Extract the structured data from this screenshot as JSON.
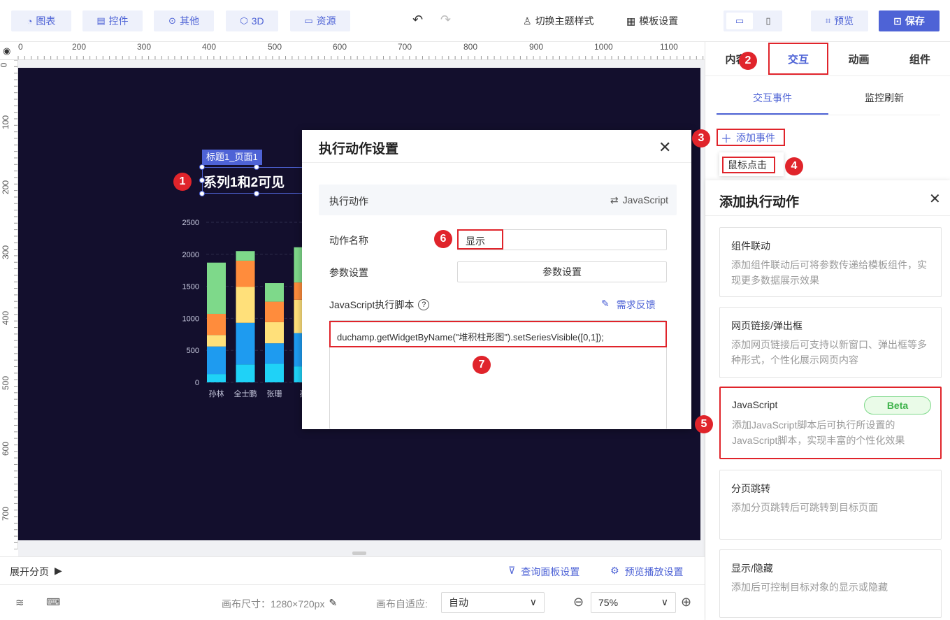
{
  "toolbar": {
    "chart": "图表",
    "widget": "控件",
    "other": "其他",
    "three_d": "3D",
    "resource": "资源",
    "switch_theme": "切换主题样式",
    "template_settings": "模板设置",
    "preview": "预览",
    "save": "保存"
  },
  "ruler": {
    "top": [
      "0",
      "200",
      "300",
      "400",
      "500",
      "600",
      "700",
      "800",
      "900",
      "1000",
      "1100"
    ],
    "left": [
      "0",
      "100",
      "200",
      "300",
      "400",
      "500",
      "600",
      "700"
    ]
  },
  "canvas": {
    "title_tag": "标题1_页面1",
    "title_text": "系列1和2可见"
  },
  "chart_data": {
    "type": "bar",
    "stacked": true,
    "categories": [
      "孙林",
      "全士鹏",
      "张珊",
      "孙"
    ],
    "ylim": [
      0,
      2500
    ],
    "yticks": [
      0,
      500,
      1000,
      1500,
      2000,
      2500
    ],
    "series": [
      {
        "color": "#1fd2f7",
        "values": [
          130,
          280,
          290,
          250
        ]
      },
      {
        "color": "#1e9bf0",
        "values": [
          430,
          650,
          320,
          520
        ]
      },
      {
        "color": "#ffe07a",
        "values": [
          180,
          560,
          330,
          520
        ]
      },
      {
        "color": "#ff8c3c",
        "values": [
          330,
          410,
          320,
          270
        ]
      },
      {
        "color": "#7ed98a",
        "values": [
          800,
          150,
          290,
          550
        ]
      }
    ]
  },
  "dialog": {
    "title": "执行动作设置",
    "exec_action_label": "执行动作",
    "exec_action_value": "JavaScript",
    "action_name_label": "动作名称",
    "action_name_value": "显示",
    "params_label": "参数设置",
    "params_button": "参数设置",
    "script_label": "JavaScript执行脚本",
    "feedback": "需求反馈",
    "script_code": "duchamp.getWidgetByName(\"堆积柱形图\").setSeriesVisible([0,1]);"
  },
  "right_panel": {
    "tabs": [
      "内容",
      "交互",
      "动画",
      "组件"
    ],
    "subtabs": [
      "交互事件",
      "监控刷新"
    ],
    "add_event": "添加事件",
    "event_item": "鼠标点击",
    "add_action_title": "添加执行动作",
    "cards": [
      {
        "title": "组件联动",
        "desc": "添加组件联动后可将参数传递给模板组件，实现更多数据展示效果"
      },
      {
        "title": "网页链接/弹出框",
        "desc": "添加网页链接后可支持以新窗口、弹出框等多种形式，个性化展示网页内容"
      },
      {
        "title": "JavaScript",
        "badge": "Beta",
        "desc": "添加JavaScript脚本后可执行所设置的JavaScript脚本，实现丰富的个性化效果"
      },
      {
        "title": "分页跳转",
        "desc": "添加分页跳转后可跳转到目标页面"
      },
      {
        "title": "显示/隐藏",
        "desc": "添加后可控制目标对象的显示或隐藏"
      }
    ]
  },
  "bottom": {
    "expand_pages": "展开分页",
    "query_panel": "查询面板设置",
    "preview_playback": "预览播放设置",
    "canvas_size": "画布尺寸：1280×720px",
    "adapt_label": "画布自适应:",
    "adapt_value": "自动",
    "zoom": "75%"
  },
  "badges": [
    "1",
    "2",
    "3",
    "4",
    "5",
    "6",
    "7"
  ],
  "colors": {
    "accent": "#4e63d6",
    "annotation": "#e0242b",
    "canvas": "#130f2d"
  }
}
